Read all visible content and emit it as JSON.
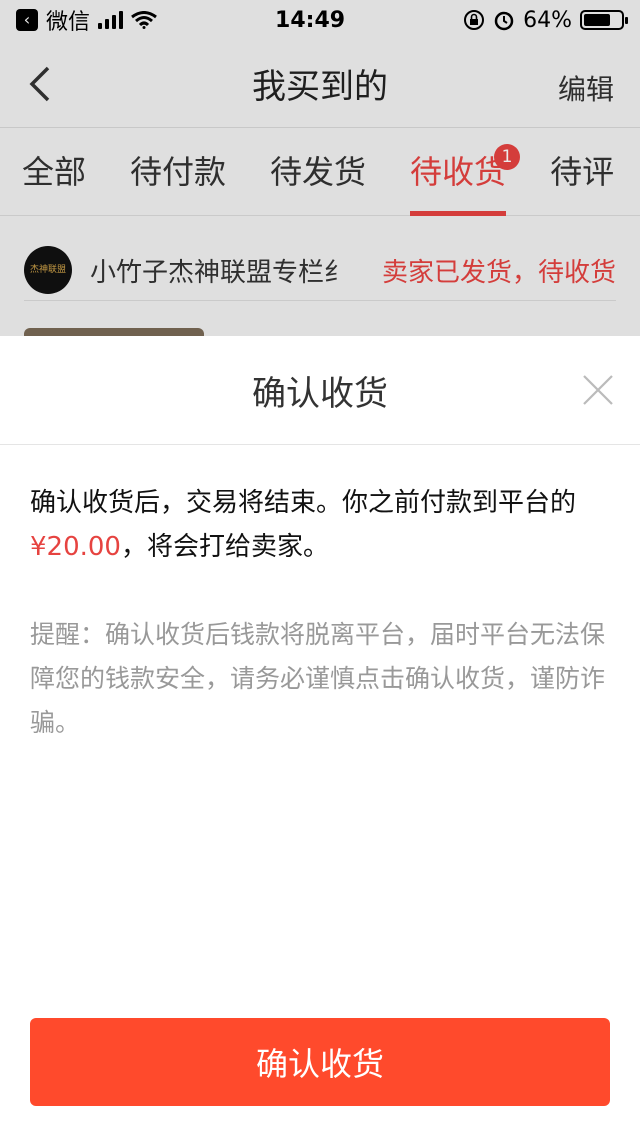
{
  "status_bar": {
    "back_app": "微信",
    "time": "14:49",
    "battery": "64%"
  },
  "nav": {
    "title": "我买到的",
    "edit": "编辑"
  },
  "tabs": [
    {
      "label": "全部"
    },
    {
      "label": "待付款"
    },
    {
      "label": "待发货"
    },
    {
      "label": "待收货",
      "badge": "1"
    },
    {
      "label": "待评"
    }
  ],
  "order": {
    "shop_logo_text": "杰神联盟",
    "shop_name": "小竹子杰神联盟专栏纟",
    "status": "卖家已发货，待收货"
  },
  "dialog": {
    "title": "确认收货",
    "message_part1": "确认收货后，交易将结束。你之前付款到平台的",
    "price": "¥20.00",
    "message_part2": "，将会打给卖家。",
    "reminder": "提醒：确认收货后钱款将脱离平台，届时平台无法保障您的钱款安全，请务必谨慎点击确认收货，谨防诈骗。",
    "confirm_label": "确认收货"
  },
  "colors": {
    "accent": "#e64340",
    "confirm_button": "#ff4a2c"
  },
  "icons": {
    "back": "chevron-left-icon",
    "close": "close-icon",
    "wifi": "wifi-icon",
    "signal": "signal-icon",
    "battery": "battery-icon",
    "alarm": "alarm-icon",
    "rotation_lock": "rotation-lock-icon"
  }
}
